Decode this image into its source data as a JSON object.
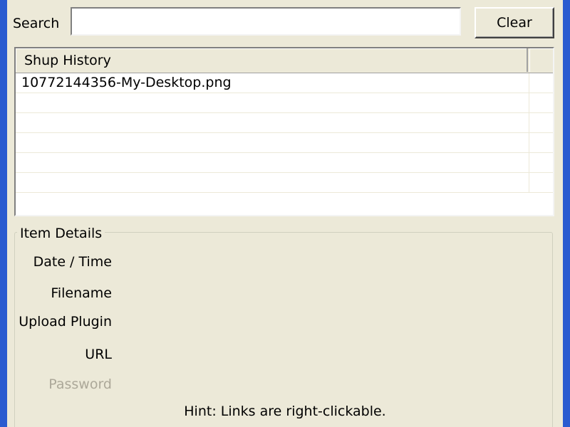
{
  "search": {
    "label": "Search",
    "value": "",
    "placeholder": "",
    "clear_label": "Clear"
  },
  "history": {
    "column_header": "Shup History",
    "rows": [
      "10772144356-My-Desktop.png",
      "",
      "",
      "",
      "",
      ""
    ]
  },
  "details": {
    "group_title": "Item Details",
    "fields": {
      "date_time": "Date / Time",
      "filename": "Filename",
      "upload_plugin": "Upload Plugin",
      "url": "URL",
      "password": "Password"
    },
    "hint": "Hint: Links are right-clickable."
  },
  "colors": {
    "window_background": "#ece9d8",
    "title_frame": "#2a5bd0",
    "disabled_text": "#aca899"
  }
}
